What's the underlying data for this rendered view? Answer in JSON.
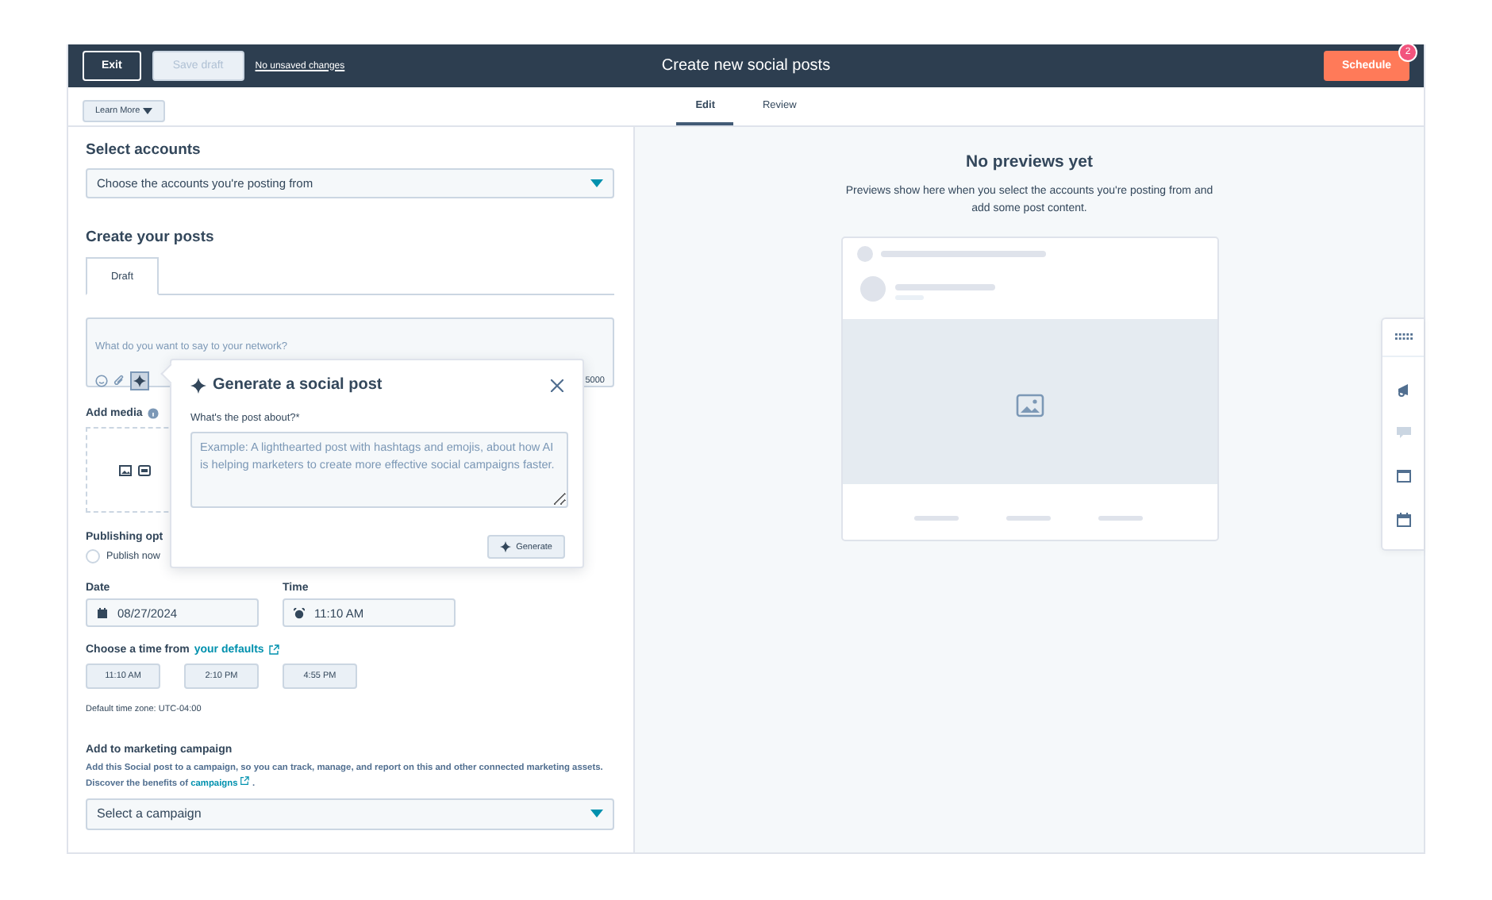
{
  "header": {
    "exit": "Exit",
    "save_draft": {
      "label": "Save draft",
      "disabled": true
    },
    "status_link": "No unsaved changes",
    "title": "Create new social posts",
    "schedule": {
      "label": "Schedule",
      "badge": "2"
    }
  },
  "subbar": {
    "learn_more": "Learn More",
    "tabs": [
      {
        "label": "Edit",
        "selected": true
      },
      {
        "label": "Review",
        "selected": false
      }
    ]
  },
  "select_accounts": {
    "heading": "Select accounts",
    "placeholder": "Choose the accounts you're posting from"
  },
  "create_posts": {
    "heading": "Create your posts",
    "tabs": [
      {
        "label": "Draft",
        "selected": true
      }
    ],
    "composer": {
      "placeholder": "What do you want to say to your network?",
      "ai_active": true,
      "char_count": "5000"
    }
  },
  "add_media": {
    "label": "Add media"
  },
  "publishing": {
    "heading": "Publishing opt",
    "option": {
      "label": "Publish now",
      "checked": false
    }
  },
  "date": {
    "label": "Date",
    "value": "08/27/2024"
  },
  "time": {
    "label": "Time",
    "value": "11:10 AM"
  },
  "defaults": {
    "prefix": "Choose a time from",
    "link": "your defaults"
  },
  "time_chips": [
    "11:10 AM",
    "2:10 PM",
    "4:55 PM"
  ],
  "timezone": "Default time zone: UTC-04:00",
  "campaign": {
    "heading": "Add to marketing campaign",
    "description": "Add this Social post to a campaign, so you can track, manage, and report on this and other connected marketing assets. Discover the benefits of",
    "link": "campaigns",
    "after": ".",
    "placeholder": "Select a campaign"
  },
  "preview": {
    "title": "No previews yet",
    "text": "Previews show here when you select the accounts you're posting from and add some post content."
  },
  "popover": {
    "title": "Generate a social post",
    "field_label": "What's the post about?*",
    "placeholder": "Example: A lighthearted post with hashtags and emojis, about how AI is helping marketers to create more effective social campaigns faster.",
    "button": "Generate"
  }
}
